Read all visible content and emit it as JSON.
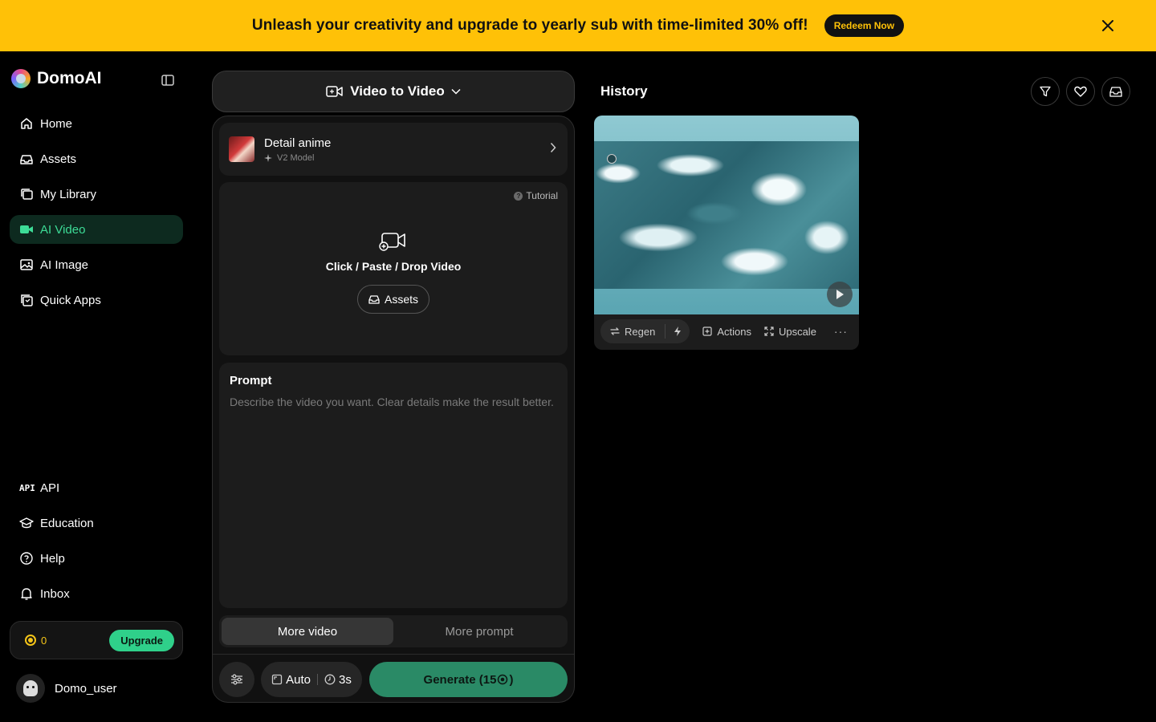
{
  "banner": {
    "text": "Unleash your creativity and upgrade to yearly sub with time-limited 30% off!",
    "cta": "Redeem Now",
    "bg_color": "#ffc107"
  },
  "sidebar": {
    "brand": "DomoAI",
    "items": [
      {
        "label": "Home",
        "icon": "home-icon"
      },
      {
        "label": "Assets",
        "icon": "assets-icon"
      },
      {
        "label": "My Library",
        "icon": "library-icon"
      },
      {
        "label": "AI Video",
        "icon": "video-camera-icon",
        "active": true
      },
      {
        "label": "AI Image",
        "icon": "image-icon"
      },
      {
        "label": "Quick Apps",
        "icon": "apps-icon"
      }
    ],
    "bottom_items": [
      {
        "label": "API",
        "icon": "api-icon"
      },
      {
        "label": "Education",
        "icon": "graduation-cap-icon"
      },
      {
        "label": "Help",
        "icon": "help-icon"
      },
      {
        "label": "Inbox",
        "icon": "bell-icon"
      }
    ],
    "credits": "0",
    "upgrade_label": "Upgrade",
    "username": "Domo_user",
    "accent_color": "#3ddc97"
  },
  "generator": {
    "mode": "Video to Video",
    "model": {
      "name": "Detail anime",
      "version": "V2 Model"
    },
    "upload": {
      "tutorial": "Tutorial",
      "instruction": "Click / Paste / Drop Video",
      "assets_button": "Assets"
    },
    "prompt": {
      "title": "Prompt",
      "placeholder": "Describe the video you want. Clear details make the result better."
    },
    "toggle": {
      "option_a": "More video",
      "option_b": "More prompt",
      "selected": "More video"
    },
    "params": {
      "ratio": "Auto",
      "duration": "3s"
    },
    "generate_label": "Generate (15",
    "generate_suffix": ")",
    "generate_color": "#2a8a66"
  },
  "history": {
    "title": "History",
    "card": {
      "actions": {
        "regen": "Regen",
        "actions": "Actions",
        "upscale": "Upscale",
        "more": "···"
      }
    }
  }
}
